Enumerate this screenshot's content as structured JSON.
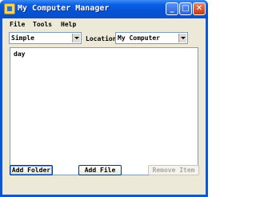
{
  "window": {
    "title": "My Computer Manager",
    "controls": {
      "minimize": "_",
      "maximize": "□",
      "close": "✕"
    }
  },
  "menu": [
    "File",
    "Tools",
    "Help"
  ],
  "toolbar": {
    "view_mode": "Simple",
    "location_label": "Location",
    "location_value": "My Computer"
  },
  "list": {
    "items": [
      "day"
    ]
  },
  "buttons": {
    "add_folder": "Add Folder",
    "add_file": "Add File",
    "remove_item": "Remove Item"
  },
  "icons": [
    "app-icon",
    "dropdown-arrow-icon"
  ]
}
